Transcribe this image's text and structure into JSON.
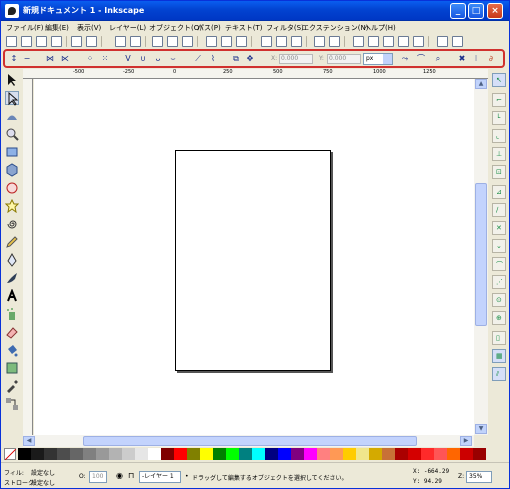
{
  "window": {
    "title": "新規ドキュメント 1 - Inkscape",
    "buttons": [
      "_",
      "□",
      "×"
    ]
  },
  "menubar": {
    "items": [
      "ファイル(F)",
      "編集(E)",
      "表示(V)",
      "レイヤー(L)",
      "オブジェクト(O)",
      "パス(P)",
      "テキスト(T)",
      "フィルタ(S)",
      "エクステンション(N)",
      "ヘルプ(H)"
    ]
  },
  "controls": {
    "x_label": "X:",
    "x_value": "0.000",
    "y_label": "Y:",
    "y_value": "0.000",
    "unit": "px"
  },
  "ruler": {
    "top_labels": [
      "-500",
      "-250",
      "0",
      "250",
      "500",
      "750",
      "1000",
      "1250"
    ]
  },
  "palette": {
    "colors": [
      "#000000",
      "#1a1a1a",
      "#333333",
      "#4d4d4d",
      "#666666",
      "#808080",
      "#999999",
      "#b3b3b3",
      "#cccccc",
      "#e6e6e6",
      "#ffffff",
      "#800000",
      "#ff0000",
      "#808000",
      "#ffff00",
      "#008000",
      "#00ff00",
      "#008080",
      "#00ffff",
      "#000080",
      "#0000ff",
      "#800080",
      "#ff00ff",
      "#ff8080",
      "#ff9955",
      "#ffcc00",
      "#f0e68c",
      "#d4aa00",
      "#c87137",
      "#aa0000",
      "#d40000",
      "#ff2a2a",
      "#ff5555",
      "#ff6600",
      "#cc0000",
      "#990000"
    ],
    "none_label": "なし"
  },
  "status": {
    "fill_label": "フィル:",
    "fill_value": "設定なし",
    "stroke_label": "ストローク:",
    "stroke_value": "設定なし",
    "opacity_label": "O:",
    "opacity_value": "100",
    "layer": "-レイヤー 1",
    "message": "ドラッグして編集するオブジェクトを選択してください。",
    "x_coord": "X: -664.29",
    "y_coord": "Y:   94.29",
    "zoom_label": "Z:",
    "zoom_value": "35%"
  }
}
